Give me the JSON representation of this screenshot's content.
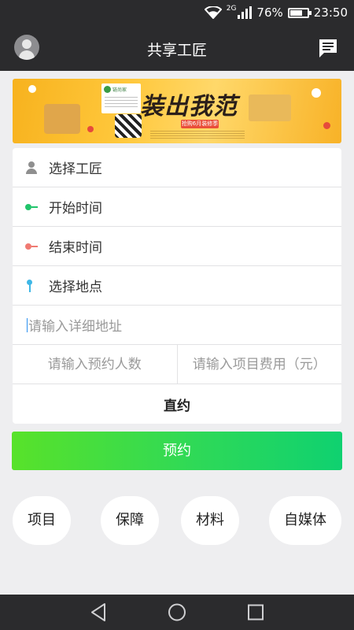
{
  "status_bar": {
    "network": "2G",
    "battery_percent": "76%",
    "battery_level": 0.76,
    "time": "23:50",
    "icons": [
      "wifi-icon",
      "signal-icon",
      "battery-icon"
    ]
  },
  "app_bar": {
    "title": "共享工匠",
    "left_icon": "avatar-icon",
    "right_icon": "message-icon"
  },
  "banner": {
    "card_text": "链尚家",
    "slogan": "装出我范",
    "tag": "抢购6月装修季"
  },
  "form": {
    "select_worker": "选择工匠",
    "start_time": "开始时间",
    "end_time": "结束时间",
    "select_location": "选择地点",
    "address_placeholder": "请输入详细地址",
    "people_placeholder": "请输入预约人数",
    "fee_placeholder": "请输入项目费用（元）",
    "direct": "直约"
  },
  "book_button": "预约",
  "categories": [
    "项目",
    "保障",
    "材料",
    "自媒体"
  ],
  "colors": {
    "dark_bar": "#2b2b2d",
    "background": "#eeeef0",
    "start_dot": "#21c46b",
    "end_dot": "#f07a72",
    "pin": "#3fb7e6",
    "button_gradient_start": "#58e22a",
    "button_gradient_end": "#0fd170"
  },
  "nav_bar": [
    "back-icon",
    "home-icon",
    "recents-icon"
  ]
}
